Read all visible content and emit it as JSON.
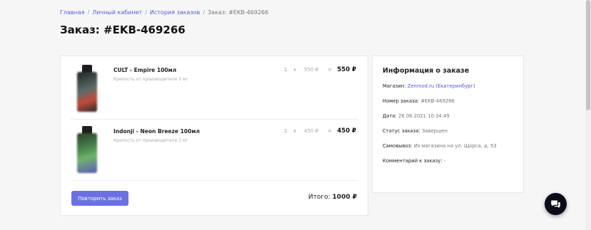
{
  "breadcrumb": {
    "items": [
      "Главная",
      "Личный кабинет",
      "История заказов"
    ],
    "current": "Заказ: #EKB-469266"
  },
  "page_title": "Заказ: #EKB-469266",
  "order_items": [
    {
      "name": "CULT - Empire 100мл",
      "subtitle": "Крепость от производителя 3 мг",
      "qty": "1",
      "unit_price": "550 ₽",
      "total": "550 ₽",
      "thumb_icon": "vape-bottle-image"
    },
    {
      "name": "Indonji - Neon Breeze 100мл",
      "subtitle": "Крепость от производителя 3 мг",
      "qty": "1",
      "unit_price": "450 ₽",
      "total": "450 ₽",
      "thumb_icon": "vape-bottle-image"
    }
  ],
  "symbols": {
    "multiply": "x",
    "equals": "="
  },
  "repeat_button": "Повторить заказ",
  "summary": {
    "label": "Итого:",
    "value": "1000 ₽"
  },
  "info": {
    "title": "Информация о заказе",
    "shop_label": "Магазин:",
    "shop_value": "Zenmod.ru (Екатеринбург)",
    "number_label": "Номер заказа:",
    "number_value": "#EKB-469266",
    "date_label": "Дата:",
    "date_value": "26.06.2021 10:34:49",
    "status_label": "Статус заказа:",
    "status_value": "Завершен",
    "pickup_label": "Самовывоз:",
    "pickup_value": "Из магазина на ул. Щорса, д. 53",
    "comment_label": "Комментарий к заказу:",
    "comment_value": "-"
  },
  "chat_icon": "chat-bubbles-icon",
  "colors": {
    "accent": "#6a72e3",
    "link": "#4e59d6",
    "chat_bg": "#0b0b1a"
  }
}
